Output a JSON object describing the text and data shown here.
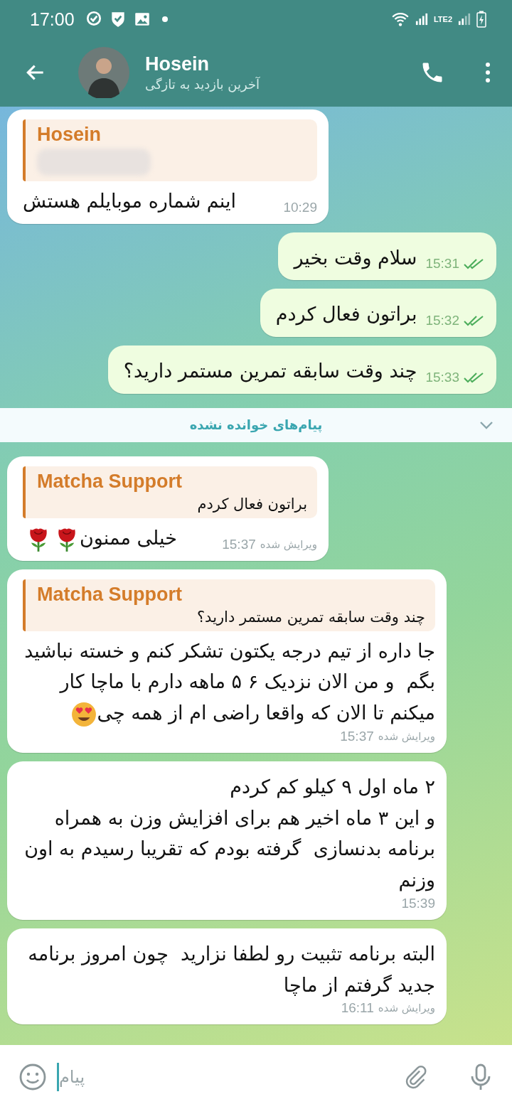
{
  "status_bar": {
    "time": "17:00",
    "network": "LTE2"
  },
  "header": {
    "name": "Hosein",
    "status": "آخرین بازدید به تازگی"
  },
  "messages": [
    {
      "kind": "incoming",
      "quote": {
        "name": "Hosein",
        "blurred": true
      },
      "text": "اینم شماره موبایلم هستش",
      "time": "10:29"
    },
    {
      "kind": "outgoing",
      "text": "سلام وقت بخیر",
      "time": "15:31",
      "read": true
    },
    {
      "kind": "outgoing",
      "text": "براتون فعال کردم",
      "time": "15:32",
      "read": true
    },
    {
      "kind": "outgoing",
      "text": "چند وقت سابقه تمرین مستمر دارید؟",
      "time": "15:33",
      "read": true
    },
    {
      "kind": "divider",
      "text": "پیام‌های خوانده نشده"
    },
    {
      "kind": "incoming",
      "quote": {
        "name": "Matcha Support",
        "text": "براتون فعال کردم"
      },
      "text": "خیلی ممنون",
      "emoji": [
        {
          "kind": "rose"
        },
        {
          "kind": "rose"
        }
      ],
      "edited_label": "ویرایش شده",
      "time": "15:37"
    },
    {
      "kind": "incoming",
      "quote": {
        "name": "Matcha Support",
        "text": "چند وقت سابقه تمرین مستمر دارید؟"
      },
      "text": "جا داره از تیم درجه یکتون تشکر کنم و خسته نباشید  بگم  و من الان نزدیک ۶ ۵ ماهه دارم با ماچا کار میکنم تا الان که واقعا راضی ام از همه چی",
      "emoji": [
        {
          "kind": "heart-eyes"
        }
      ],
      "edited_label": "ویرایش شده",
      "time": "15:37"
    },
    {
      "kind": "incoming",
      "text": "۲ ماه اول ۹ کیلو کم کردم\nو این ۳ ماه اخیر هم برای افزایش وزن به همراه برنامه بدنسازی  گرفته بودم که تقریبا رسیدم به اون وزنم",
      "time": "15:39"
    },
    {
      "kind": "incoming",
      "text": "البته برنامه تثبیت رو لطفا نزارید  چون امروز برنامه جدید گرفتم از ماچا",
      "edited_label": "ویرایش شده",
      "time": "16:11"
    }
  ],
  "composer": {
    "placeholder": "پیام"
  }
}
